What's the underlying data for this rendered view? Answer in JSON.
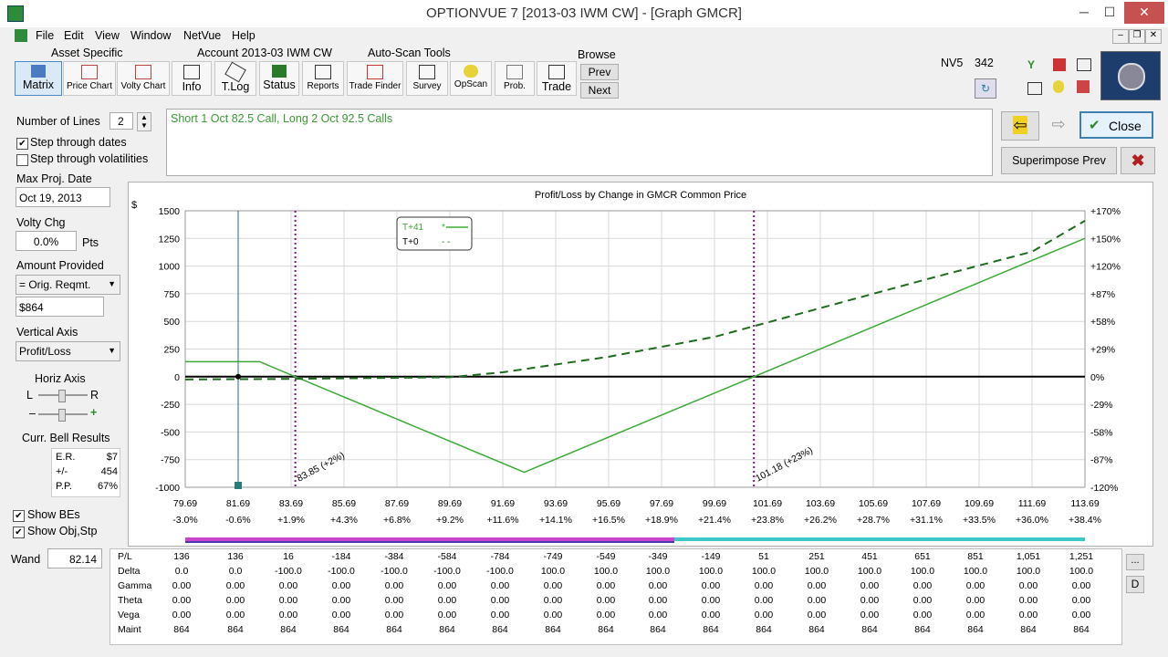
{
  "window": {
    "title": "OPTIONVUE 7   [2013-03 IWM CW] - [Graph GMCR]",
    "minimize": "─",
    "maximize": "☐",
    "close": "✕"
  },
  "menu": [
    "File",
    "Edit",
    "View",
    "Window",
    "NetVue",
    "Help"
  ],
  "groups": {
    "asset": "Asset Specific",
    "account": "Account 2013-03 IWM CW",
    "autoscan": "Auto-Scan Tools",
    "browse": "Browse"
  },
  "toolbar": [
    {
      "label": "Matrix"
    },
    {
      "label": "Price Chart"
    },
    {
      "label": "Volty Chart"
    },
    {
      "label": "Info"
    },
    {
      "label": "T.Log"
    },
    {
      "label": "Status"
    },
    {
      "label": "Reports"
    },
    {
      "label": "Trade Finder"
    },
    {
      "label": "Survey"
    },
    {
      "label": "OpScan"
    },
    {
      "label": "Prob."
    },
    {
      "label": "Trade"
    }
  ],
  "browse": {
    "prev": "Prev",
    "next": "Next"
  },
  "status": {
    "nv5": "NV5",
    "num": "342"
  },
  "left": {
    "lines_label": "Number of Lines",
    "lines_value": "2",
    "step_dates": "Step through dates",
    "step_vols": "Step through volatilities",
    "max_proj_label": "Max Proj. Date",
    "max_proj_value": "Oct 19, 2013",
    "volty_label": "Volty Chg",
    "volty_value": "0.0%",
    "volty_unit": "Pts",
    "amount_label": "Amount Provided",
    "amount_select": "= Orig. Reqmt.",
    "amount_value": "$864",
    "vaxis_label": "Vertical Axis",
    "vaxis_select": "Profit/Loss",
    "haxis_label": "Horiz Axis",
    "haxis_L": "L",
    "haxis_R": "R",
    "haxis_minus": "–",
    "haxis_plus": "+",
    "bell_label": "Curr. Bell Results",
    "bell": [
      {
        "k": "E.R.",
        "v": "$7"
      },
      {
        "k": "+/-",
        "v": "454"
      },
      {
        "k": "P.P.",
        "v": "67%"
      }
    ],
    "show_bes": "Show BEs",
    "show_obj": "Show Obj,Stp",
    "wand_label": "Wand",
    "wand_value": "82.14"
  },
  "description": "Short 1 Oct 82.5 Call, Long 2 Oct 92.5 Calls",
  "right_buttons": {
    "close": "Close",
    "superimpose": "Superimpose Prev"
  },
  "grid_buttons": {
    "dots": "...",
    "d": "D"
  },
  "chart_data": {
    "type": "line",
    "title": "Profit/Loss by Change in GMCR Common Price",
    "ylabel": "$",
    "ylim": [
      -1000,
      1500
    ],
    "y_ticks": [
      "1500",
      "1250",
      "1000",
      "750",
      "500",
      "250",
      "0",
      "-250",
      "-500",
      "-750",
      "-1000"
    ],
    "y2_ticks": [
      "+170%",
      "+150%",
      "+120%",
      "+87%",
      "+58%",
      "+29%",
      "0%",
      "-29%",
      "-58%",
      "-87%",
      "-120%"
    ],
    "xlim": [
      79.69,
      113.69
    ],
    "x_ticks": [
      "79.69",
      "81.69",
      "83.69",
      "85.69",
      "87.69",
      "89.69",
      "91.69",
      "93.69",
      "95.69",
      "97.69",
      "99.69",
      "101.69",
      "103.69",
      "105.69",
      "107.69",
      "109.69",
      "111.69",
      "113.69"
    ],
    "x_pct": [
      "-3.0%",
      "-0.6%",
      "+1.9%",
      "+4.3%",
      "+6.8%",
      "+9.2%",
      "+11.6%",
      "+14.1%",
      "+16.5%",
      "+18.9%",
      "+21.4%",
      "+23.8%",
      "+26.2%",
      "+28.7%",
      "+31.1%",
      "+33.5%",
      "+36.0%",
      "+38.4%"
    ],
    "series": [
      {
        "name": "T+41",
        "style": "solid",
        "color": "#3aaa35",
        "x": [
          79.69,
          82.5,
          83.85,
          92.5,
          101.18,
          113.69
        ],
        "y": [
          136,
          136,
          0,
          -864,
          0,
          1251
        ]
      },
      {
        "name": "T+0",
        "style": "dashed",
        "color": "#1e6b1e",
        "x": [
          79.69,
          83.69,
          89.69,
          91.69,
          95.69,
          99.69,
          103.69,
          107.69,
          111.69,
          113.69
        ],
        "y": [
          -25,
          -20,
          -5,
          40,
          180,
          360,
          620,
          880,
          1130,
          1410
        ]
      }
    ],
    "legend": {
      "position": "top-left",
      "t41": "T+41",
      "t41_mark": "*",
      "t0": "T+0",
      "t0_mark": "- -"
    },
    "breakevens": [
      {
        "x": 83.85,
        "label": "83.85 (+2%)"
      },
      {
        "x": 101.18,
        "label": "101.18 (+23%)"
      }
    ],
    "marker": {
      "x": 81.69
    },
    "colors": {
      "magenta": "#cc44cc",
      "cyan": "#3cc8c8",
      "solid": "#3aaa35",
      "dashed": "#1e6b1e"
    }
  },
  "grid": {
    "rows": [
      {
        "label": "P/L",
        "values": [
          "136",
          "136",
          "16",
          "-184",
          "-384",
          "-584",
          "-784",
          "-749",
          "-549",
          "-349",
          "-149",
          "51",
          "251",
          "451",
          "651",
          "851",
          "1,051",
          "1,251"
        ]
      },
      {
        "label": "Delta",
        "values": [
          "0.0",
          "0.0",
          "-100.0",
          "-100.0",
          "-100.0",
          "-100.0",
          "-100.0",
          "100.0",
          "100.0",
          "100.0",
          "100.0",
          "100.0",
          "100.0",
          "100.0",
          "100.0",
          "100.0",
          "100.0",
          "100.0"
        ]
      },
      {
        "label": "Gamma",
        "values": [
          "0.00",
          "0.00",
          "0.00",
          "0.00",
          "0.00",
          "0.00",
          "0.00",
          "0.00",
          "0.00",
          "0.00",
          "0.00",
          "0.00",
          "0.00",
          "0.00",
          "0.00",
          "0.00",
          "0.00",
          "0.00"
        ]
      },
      {
        "label": "Theta",
        "values": [
          "0.00",
          "0.00",
          "0.00",
          "0.00",
          "0.00",
          "0.00",
          "0.00",
          "0.00",
          "0.00",
          "0.00",
          "0.00",
          "0.00",
          "0.00",
          "0.00",
          "0.00",
          "0.00",
          "0.00",
          "0.00"
        ]
      },
      {
        "label": "Vega",
        "values": [
          "0.00",
          "0.00",
          "0.00",
          "0.00",
          "0.00",
          "0.00",
          "0.00",
          "0.00",
          "0.00",
          "0.00",
          "0.00",
          "0.00",
          "0.00",
          "0.00",
          "0.00",
          "0.00",
          "0.00",
          "0.00"
        ]
      },
      {
        "label": "Maint",
        "values": [
          "864",
          "864",
          "864",
          "864",
          "864",
          "864",
          "864",
          "864",
          "864",
          "864",
          "864",
          "864",
          "864",
          "864",
          "864",
          "864",
          "864",
          "864"
        ]
      }
    ]
  }
}
